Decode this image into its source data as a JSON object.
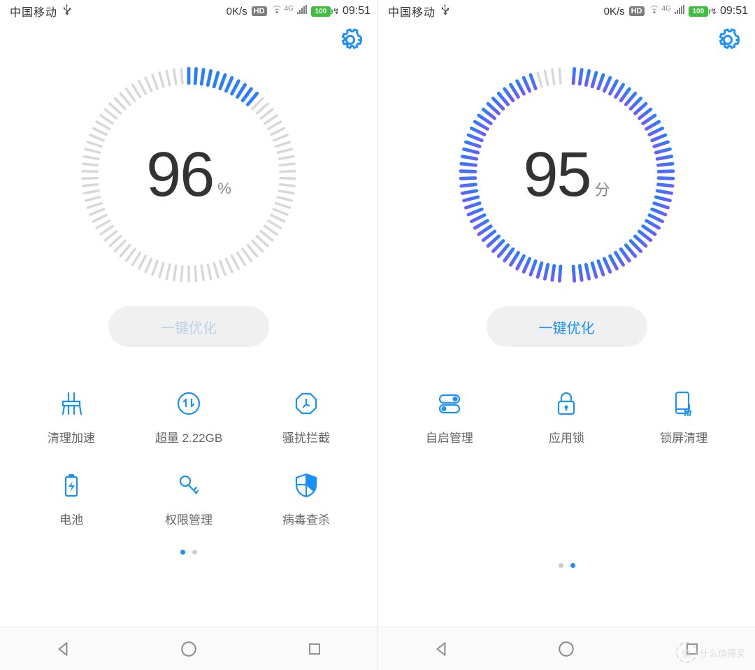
{
  "status_bar": {
    "carrier": "中国移动",
    "net_speed": "0K/s",
    "hd_badge": "HD",
    "fourg": "4G",
    "battery_text": "100",
    "time": "09:51"
  },
  "left": {
    "score": "96",
    "unit": "%",
    "optimize_label": "一键优化",
    "optimize_enabled": false,
    "gauge_fill_percent": 12,
    "tiles": [
      {
        "id": "cleanup",
        "label": "清理加速"
      },
      {
        "id": "traffic",
        "label": "超量 2.22GB"
      },
      {
        "id": "block",
        "label": "骚扰拦截"
      },
      {
        "id": "battery",
        "label": "电池"
      },
      {
        "id": "perm",
        "label": "权限管理"
      },
      {
        "id": "virus",
        "label": "病毒查杀"
      }
    ],
    "page_index": 0,
    "page_count": 2
  },
  "right": {
    "score": "95",
    "unit": "分",
    "optimize_label": "一键优化",
    "optimize_enabled": true,
    "gauge_fill_percent": 95,
    "tiles": [
      {
        "id": "autostart",
        "label": "自启管理"
      },
      {
        "id": "applock",
        "label": "应用锁"
      },
      {
        "id": "lockscreen",
        "label": "锁屏清理"
      }
    ],
    "page_index": 1,
    "page_count": 2
  },
  "watermark": {
    "text": "什么值得买",
    "short": "值"
  }
}
